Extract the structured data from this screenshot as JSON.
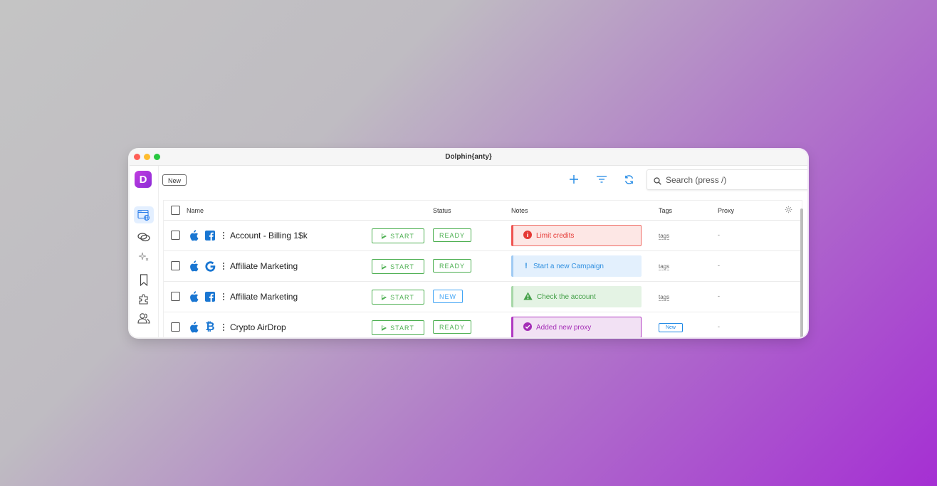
{
  "window": {
    "title": "Dolphin{anty}"
  },
  "toolbar": {
    "new_label": "New",
    "add_icon": "plus-icon",
    "filter_icon": "filter-icon",
    "refresh_icon": "refresh-icon",
    "search_placeholder": "Search (press /)"
  },
  "sidebar": {
    "logo_letter": "D",
    "items": [
      {
        "icon": "browser-profiles-icon",
        "active": true
      },
      {
        "icon": "proxy-links-icon"
      },
      {
        "icon": "automation-sparkle-icon"
      },
      {
        "icon": "bookmark-icon"
      },
      {
        "icon": "extensions-puzzle-icon"
      },
      {
        "icon": "users-icon"
      }
    ]
  },
  "table": {
    "headers": {
      "name": "Name",
      "status": "Status",
      "notes": "Notes",
      "tags": "Tags",
      "proxy": "Proxy"
    },
    "rows": [
      {
        "os": "apple-icon",
        "platform": "facebook-icon",
        "name": "Account - Billing 1$k",
        "start": "START",
        "status": "READY",
        "note": "Limit credits",
        "note_type": "red",
        "tags": "tags",
        "proxy": "-"
      },
      {
        "os": "apple-icon",
        "platform": "google-icon",
        "name": "Affiliate Marketing",
        "start": "START",
        "status": "READY",
        "note": "Start a new Campaign",
        "note_type": "blue",
        "tags": "tags",
        "proxy": "-"
      },
      {
        "os": "apple-icon",
        "platform": "facebook-icon",
        "name": "Affiliate Marketing",
        "start": "START",
        "status": "NEW",
        "note": "Check the account",
        "note_type": "green",
        "tags": "tags",
        "proxy": "-"
      },
      {
        "os": "apple-icon",
        "platform": "bitcoin-icon",
        "name": "Crypto AirDrop",
        "start": "START",
        "status": "READY",
        "note": "Added new proxy",
        "note_type": "purple",
        "tag_badge": "New",
        "proxy": "-"
      }
    ]
  },
  "colors": {
    "brand": "#a93ce0",
    "start_green": "#4caf50",
    "new_blue": "#42a5f5",
    "note_red": "#e53935",
    "note_blue": "#2f8fe0",
    "note_green": "#45a049",
    "note_purple": "#a42db6"
  }
}
